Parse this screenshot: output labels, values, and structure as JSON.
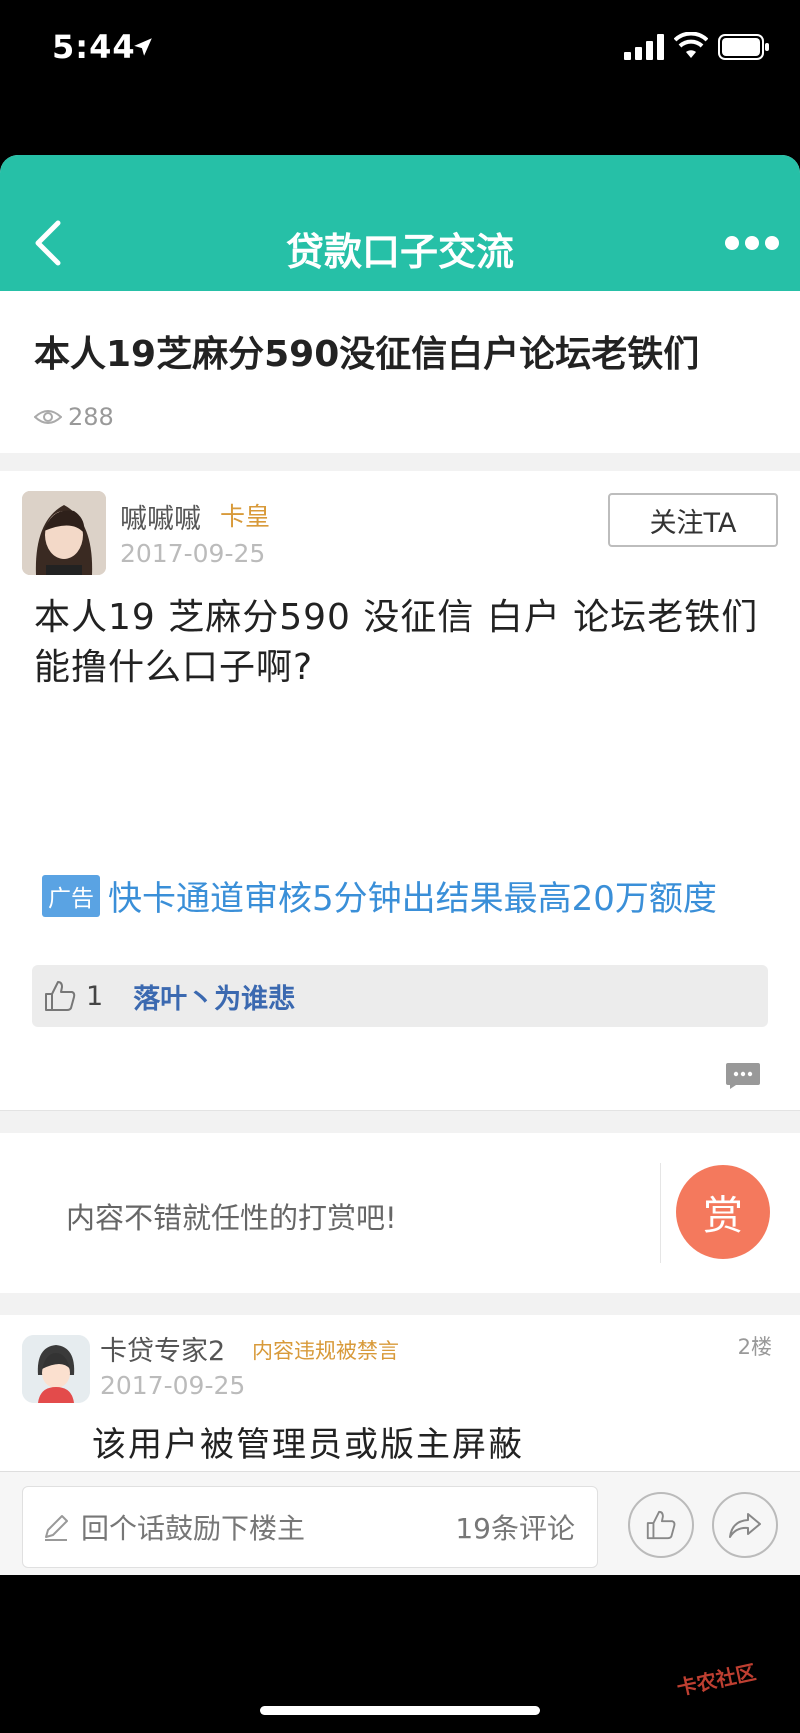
{
  "status": {
    "time": "5:44"
  },
  "nav": {
    "title": "贷款口子交流"
  },
  "post": {
    "title": "本人19芝麻分590没征信白户论坛老铁们",
    "views": "288",
    "author": "嘁嘁嘁",
    "author_badge": "卡皇",
    "date": "2017-09-25",
    "follow_label": "关注TA",
    "body": "本人19 芝麻分590 没征信 白户 论坛老铁们 能撸什么口子啊?"
  },
  "ad": {
    "tag": "广告",
    "text": "快卡通道审核5分钟出结果最高20万额度"
  },
  "likes": {
    "count": "1",
    "user": "落叶丶为谁悲"
  },
  "reward": {
    "prompt": "内容不错就任性的打赏吧!",
    "button": "赏"
  },
  "reply": {
    "author": "卡贷专家2",
    "badge": "内容违规被禁言",
    "floor": "2楼",
    "date": "2017-09-25",
    "body": "该用户被管理员或版主屏蔽"
  },
  "bottom": {
    "input_placeholder": "回个话鼓励下楼主",
    "comment_count": "19条评论"
  },
  "watermark": "卡农社区",
  "colors": {
    "accent": "#26c0a7",
    "link": "#3a8fd8",
    "badge": "#d89a3a",
    "reward": "#f4795d"
  }
}
